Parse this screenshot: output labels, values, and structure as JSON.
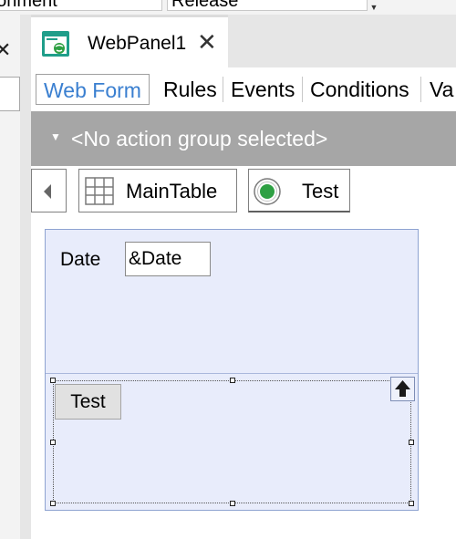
{
  "toolbar": {
    "environment_value": "vironment",
    "config_value": "Release"
  },
  "tab": {
    "title": "WebPanel1",
    "close_glyph": "✕"
  },
  "subtabs": {
    "items": [
      {
        "label": "Web Form"
      },
      {
        "label": "Rules"
      },
      {
        "label": "Events"
      },
      {
        "label": "Conditions"
      },
      {
        "label": "Va"
      }
    ]
  },
  "action_group": {
    "caret": "▼",
    "text": "<No action group selected>"
  },
  "breadcrumb": {
    "main_table": "MainTable",
    "test": "Test"
  },
  "form": {
    "date_label": "Date",
    "date_value": "&Date",
    "test_button": "Test"
  },
  "colors": {
    "accent": "#3a7fd0",
    "action_bar": "#a6a6a6",
    "canvas": "#e8ecfb",
    "radio_green": "#2ea043"
  },
  "icons": {
    "doc": "webpanel-icon",
    "grid": "table-grid-icon",
    "radio": "radio-selected-icon",
    "back": "chevron-left-icon",
    "up": "arrow-up-icon"
  }
}
